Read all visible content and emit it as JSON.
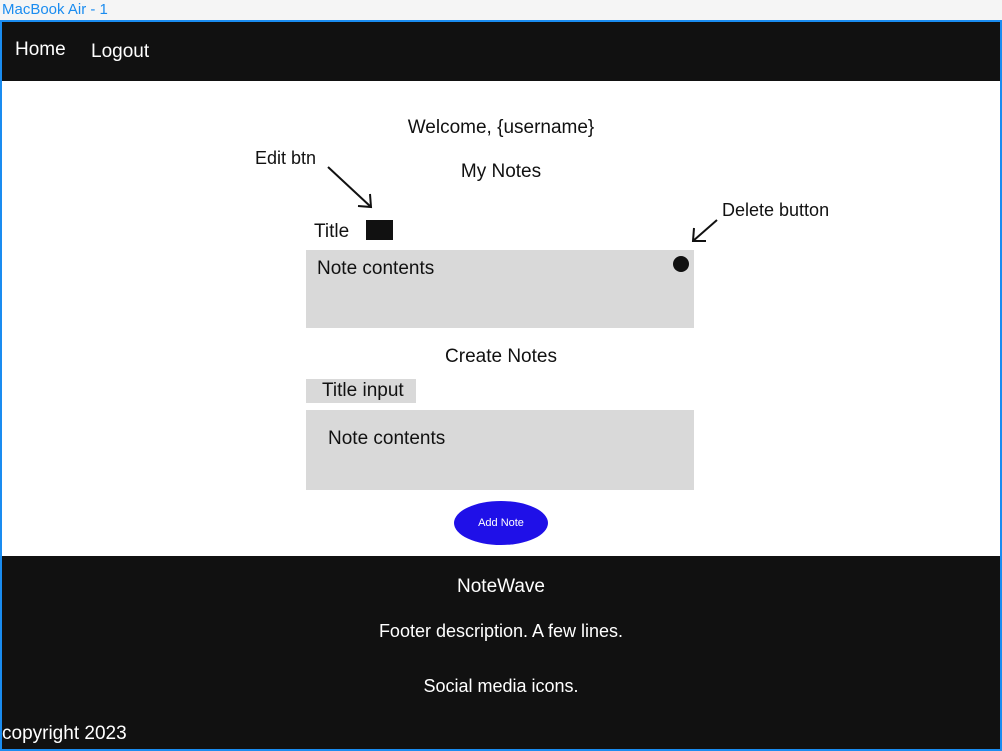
{
  "frame": {
    "label": "MacBook Air - 1"
  },
  "nav": {
    "home": "Home",
    "logout": "Logout"
  },
  "main": {
    "welcome": "Welcome, {username}",
    "my_notes_heading": "My Notes",
    "annotations": {
      "edit": "Edit btn",
      "delete": "Delete button"
    },
    "note": {
      "title": "Title",
      "contents": "Note contents"
    }
  },
  "create": {
    "heading": "Create Notes",
    "title_placeholder": "Title input",
    "contents_placeholder": "Note contents",
    "add_button": "Add Note"
  },
  "footer": {
    "brand": "NoteWave",
    "description": "Footer description. A few lines.",
    "social": "Social media icons.",
    "copyright": "copyright 2023"
  },
  "colors": {
    "frame_border": "#1a8cf0",
    "nav_background": "#111111",
    "card_background": "#d9d9d9",
    "add_button": "#1f10e8"
  },
  "icons": {
    "edit": "edit-icon",
    "delete": "delete-icon"
  }
}
